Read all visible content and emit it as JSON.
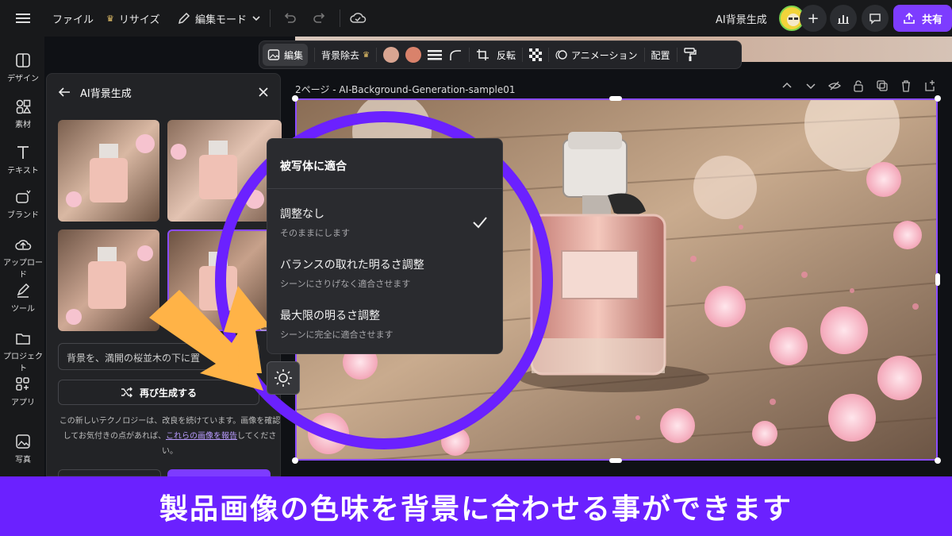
{
  "topbar": {
    "file_label": "ファイル",
    "resize_label": "リサイズ",
    "edit_mode_label": "編集モード",
    "ai_bg_label": "AI背景生成",
    "share_label": "共有"
  },
  "rail": {
    "items": [
      {
        "label": "デザイン",
        "icon": "layout-icon"
      },
      {
        "label": "素材",
        "icon": "elements-icon"
      },
      {
        "label": "テキスト",
        "icon": "text-icon"
      },
      {
        "label": "ブランド",
        "icon": "brand-icon"
      },
      {
        "label": "アップロード",
        "icon": "upload-icon"
      },
      {
        "label": "ツール",
        "icon": "pen-icon"
      },
      {
        "label": "プロジェクト",
        "icon": "folder-icon"
      },
      {
        "label": "アプリ",
        "icon": "apps-icon"
      },
      {
        "label": "写真",
        "icon": "photo-icon"
      }
    ]
  },
  "panel": {
    "title": "AI背景生成",
    "prompt": "背景を、満開の桜並木の下に置",
    "regen_label": "再び生成する",
    "disclaimer_pre": "この新しいテクノロジーは、改良を続けています。画像を確認してお気付きの点があれば、",
    "disclaimer_link": "これらの画像を報告",
    "disclaimer_post": "してください。",
    "partial_text": "ださ"
  },
  "context_bar": {
    "edit_label": "編集",
    "bg_remove_label": "背景除去",
    "flip_label": "反転",
    "animate_label": "アニメーション",
    "position_label": "配置",
    "swatch_1": "#d9a591",
    "swatch_2": "#d9826b"
  },
  "page": {
    "title": "2ページ - AI-Background-Generation-sample01"
  },
  "dropdown": {
    "header": "被写体に適合",
    "options": [
      {
        "title": "調整なし",
        "sub": "そのままにします",
        "selected": true
      },
      {
        "title": "バランスの取れた明るさ調整",
        "sub": "シーンにさりげなく適合させます",
        "selected": false
      },
      {
        "title": "最大限の明るさ調整",
        "sub": "シーンに完全に適合させます",
        "selected": false
      }
    ]
  },
  "caption": "製品画像の色味を背景に合わせる事ができます",
  "colors": {
    "accent": "#7d3cff",
    "callout_circle": "#6b21ff",
    "arrow": "#ffb347"
  }
}
